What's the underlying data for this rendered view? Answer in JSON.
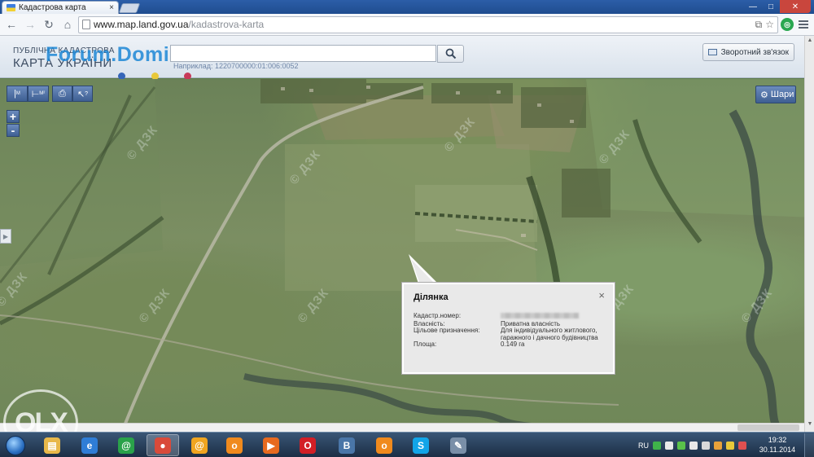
{
  "browser": {
    "tab_title": "Кадастрова карта",
    "tab_close": "×",
    "url_host": "www.map.land.gov.ua",
    "url_path": "/kadastrova-karta",
    "window_controls": [
      "—",
      "□",
      "✕"
    ]
  },
  "site": {
    "logo_line1": "ПУБЛІЧНА КАДАСТРОВА",
    "logo_line2": "КАРТА УКРАЇНИ",
    "watermark": "Forum.Domik.ua",
    "search_value": "",
    "search_hint": "Наприклад: 1220700000:01:006:0052",
    "feedback_label": "Зворотний зв'язок",
    "accent_dots": [
      "#3565b8",
      "#e8c83a",
      "#c83a5a"
    ]
  },
  "map_controls": {
    "measure_label": "М",
    "measure_area_label": "М²",
    "identify_label": "?",
    "zoom_in": "+",
    "zoom_out": "-",
    "layers_label": "Шари",
    "side_toggle": "▶",
    "watermark_text": "© ДЗК"
  },
  "popup": {
    "title": "Ділянка",
    "close": "×",
    "rows": [
      {
        "label": "Кадастр.номер:",
        "value": ""
      },
      {
        "label": "Власність:",
        "value": "Приватна власність"
      },
      {
        "label": "Цільове призначення:",
        "value": "Для індивідуального житлового, гаражного і дачного будівництва"
      },
      {
        "label": "Площа:",
        "value": "0.149 га"
      }
    ]
  },
  "watermark_olx": "OLX",
  "taskbar": {
    "apps": [
      {
        "name": "explorer",
        "color": "#e8b84a",
        "glyph": "▤"
      },
      {
        "name": "ie",
        "color": "#2f7dd6",
        "glyph": "e"
      },
      {
        "name": "icq-agent",
        "color": "#2aa24a",
        "glyph": "@"
      },
      {
        "name": "chrome",
        "color": "#d94a3a",
        "glyph": "●"
      },
      {
        "name": "mail-agent",
        "color": "#f0a520",
        "glyph": "@"
      },
      {
        "name": "odnoklassniki",
        "color": "#f08a1d",
        "glyph": "о"
      },
      {
        "name": "media-player",
        "color": "#e76a1f",
        "glyph": "▶"
      },
      {
        "name": "opera",
        "color": "#d31f26",
        "glyph": "O"
      },
      {
        "name": "vkontakte",
        "color": "#4a76a8",
        "glyph": "В"
      },
      {
        "name": "odnoklassniki-2",
        "color": "#f08a1d",
        "glyph": "о"
      },
      {
        "name": "skype",
        "color": "#12a5e8",
        "glyph": "S"
      },
      {
        "name": "paint-tool",
        "color": "#7a8fa8",
        "glyph": "✎"
      }
    ],
    "tray_lang": "RU",
    "tray_icons": [
      "#3fb24a",
      "#e9e9e9",
      "#59c24a",
      "#e9e9e9",
      "#d9d9d9",
      "#e8a23a",
      "#e8c83a",
      "#e05050"
    ],
    "time": "19:32",
    "date": "30.11.2014"
  }
}
